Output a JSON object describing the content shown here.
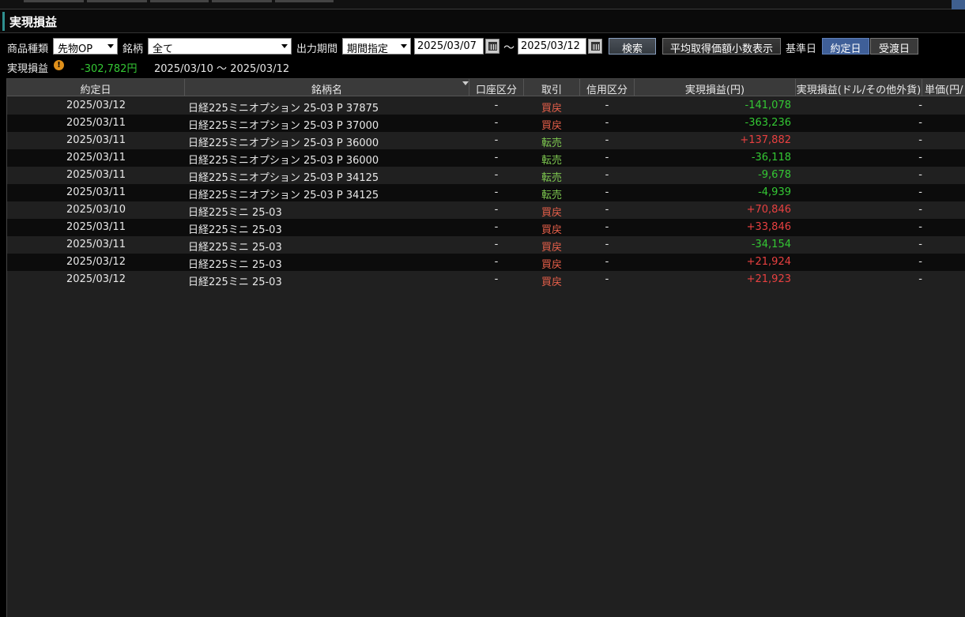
{
  "title": "実現損益",
  "filters": {
    "product_type_label": "商品種類",
    "product_type_value": "先物OP",
    "symbol_label": "銘柄",
    "symbol_value": "全て",
    "period_label": "出力期間",
    "period_value": "期間指定",
    "date_from": "2025/03/07",
    "range_sep": "～",
    "date_to": "2025/03/12",
    "search_button": "検索",
    "avg_price_button": "平均取得価額小数表示",
    "base_date_label": "基準日",
    "base_trade_date": "約定日",
    "base_delivery_date": "受渡日"
  },
  "summary": {
    "label": "実現損益",
    "value": "-302,782円",
    "range": "2025/03/10 ～ 2025/03/12"
  },
  "columns": [
    "約定日",
    "銘柄名",
    "口座区分",
    "取引",
    "信用区分",
    "実現損益(円)",
    "実現損益(ドル/その他外貨)",
    "単価(円/"
  ],
  "rows": [
    {
      "date": "2025/03/12",
      "name": "日経225ミニオプション 25-03 P 37875",
      "account": "-",
      "trade": "買戻",
      "trade_type": "buy",
      "credit": "-",
      "pl": "-141,078",
      "sign": "neg",
      "pl_fx": "-"
    },
    {
      "date": "2025/03/11",
      "name": "日経225ミニオプション 25-03 P 37000",
      "account": "-",
      "trade": "買戻",
      "trade_type": "buy",
      "credit": "-",
      "pl": "-363,236",
      "sign": "neg",
      "pl_fx": "-"
    },
    {
      "date": "2025/03/11",
      "name": "日経225ミニオプション 25-03 P 36000",
      "account": "-",
      "trade": "転売",
      "trade_type": "sell",
      "credit": "-",
      "pl": "+137,882",
      "sign": "pos",
      "pl_fx": "-"
    },
    {
      "date": "2025/03/11",
      "name": "日経225ミニオプション 25-03 P 36000",
      "account": "-",
      "trade": "転売",
      "trade_type": "sell",
      "credit": "-",
      "pl": "-36,118",
      "sign": "neg",
      "pl_fx": "-"
    },
    {
      "date": "2025/03/11",
      "name": "日経225ミニオプション 25-03 P 34125",
      "account": "-",
      "trade": "転売",
      "trade_type": "sell",
      "credit": "-",
      "pl": "-9,678",
      "sign": "neg",
      "pl_fx": "-"
    },
    {
      "date": "2025/03/11",
      "name": "日経225ミニオプション 25-03 P 34125",
      "account": "-",
      "trade": "転売",
      "trade_type": "sell",
      "credit": "-",
      "pl": "-4,939",
      "sign": "neg",
      "pl_fx": "-"
    },
    {
      "date": "2025/03/10",
      "name": "日経225ミニ 25-03",
      "account": "-",
      "trade": "買戻",
      "trade_type": "buy",
      "credit": "-",
      "pl": "+70,846",
      "sign": "pos",
      "pl_fx": "-"
    },
    {
      "date": "2025/03/11",
      "name": "日経225ミニ 25-03",
      "account": "-",
      "trade": "買戻",
      "trade_type": "buy",
      "credit": "-",
      "pl": "+33,846",
      "sign": "pos",
      "pl_fx": "-"
    },
    {
      "date": "2025/03/11",
      "name": "日経225ミニ 25-03",
      "account": "-",
      "trade": "買戻",
      "trade_type": "buy",
      "credit": "-",
      "pl": "-34,154",
      "sign": "neg",
      "pl_fx": "-"
    },
    {
      "date": "2025/03/12",
      "name": "日経225ミニ 25-03",
      "account": "-",
      "trade": "買戻",
      "trade_type": "buy",
      "credit": "-",
      "pl": "+21,924",
      "sign": "pos",
      "pl_fx": "-"
    },
    {
      "date": "2025/03/12",
      "name": "日経225ミニ 25-03",
      "account": "-",
      "trade": "買戻",
      "trade_type": "buy",
      "credit": "-",
      "pl": "+21,923",
      "sign": "pos",
      "pl_fx": "-"
    }
  ],
  "colors": {
    "positive": "#e84040",
    "negative": "#34c834",
    "buy_back": "#e8604a",
    "resell": "#7ec850",
    "active_tab": "#3f5f98",
    "warning": "#e0901a"
  },
  "icons": {
    "warning": "warning-icon",
    "calendar": "calendar-icon",
    "dropdown": "chevron-down-icon",
    "sort": "sort-down-icon"
  }
}
